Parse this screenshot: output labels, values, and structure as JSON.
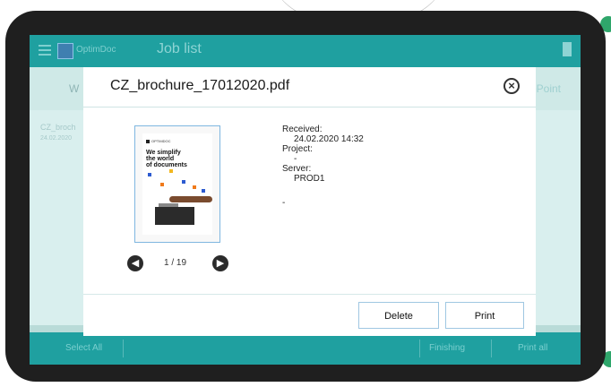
{
  "app": {
    "logo_text": "OptimDoc",
    "title": "Job list",
    "tab_left": "W",
    "tab_right": "ePoint",
    "list_item": {
      "name": "CZ_broch",
      "date": "24.02.2020"
    },
    "bottom": {
      "select_all": "Select All",
      "finishing": "Finishing",
      "print_all": "Print all"
    }
  },
  "modal": {
    "title": "CZ_brochure_17012020.pdf",
    "thumbnail": {
      "logo": "OPTIMDOC",
      "headline_1": "We simplify",
      "headline_2": "the world",
      "headline_3": "of documents"
    },
    "page_indicator": "1 / 19",
    "info": {
      "received_label": "Received:",
      "received_value": "24.02.2020 14:32",
      "project_label": "Project:",
      "project_value": "-",
      "server_label": "Server:",
      "server_value": "PROD1",
      "extra": "-"
    },
    "buttons": {
      "delete": "Delete",
      "print": "Print"
    }
  },
  "colors": {
    "accent": "#1fa0a0",
    "overlay": "#b9dbd8",
    "device": "#1f1f1f",
    "button_border": "#9fc7e2"
  },
  "icons": [
    "menu-icon",
    "logout-icon",
    "close-icon",
    "arrow-left-icon",
    "arrow-right-icon"
  ]
}
